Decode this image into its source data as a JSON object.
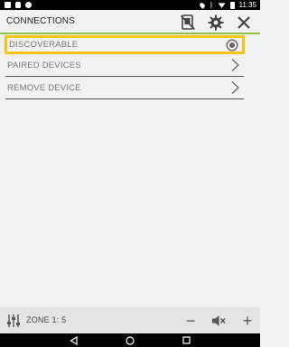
{
  "status_bar": {
    "time": "11:35",
    "left_icons": [
      "photo-icon",
      "lock-icon",
      "alarm-icon"
    ],
    "right_icons": [
      "location-icon",
      "bluetooth-icon",
      "wifi-icon",
      "battery-icon"
    ]
  },
  "header": {
    "title": "CONNECTIONS",
    "accent_color": "#8bc34a",
    "icons": [
      "no-device-icon",
      "gear-icon",
      "close-icon"
    ]
  },
  "connections": {
    "items": [
      {
        "label": "DISCOVERABLE",
        "control": "radio-icon",
        "selected": true
      },
      {
        "label": "PAIRED DEVICES",
        "control": "chevron-right-icon"
      },
      {
        "label": "REMOVE DEVICE",
        "control": "chevron-right-icon"
      }
    ],
    "highlight_color": "#f5c518"
  },
  "bottom_bar": {
    "zone_label": "ZONE 1: 5",
    "icons": [
      "equalizer-icon",
      "minus-icon",
      "mute-icon",
      "plus-icon"
    ],
    "minus_label": "−",
    "plus_label": "+"
  },
  "nav_bar": {
    "icons": [
      "back-icon",
      "home-icon",
      "recents-icon"
    ]
  }
}
